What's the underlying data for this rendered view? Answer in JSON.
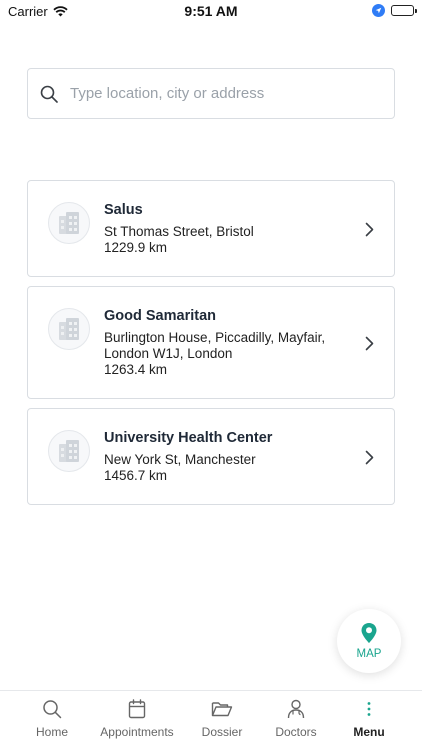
{
  "status_bar": {
    "carrier": "Carrier",
    "time": "9:51 AM"
  },
  "search": {
    "placeholder": "Type location, city or address",
    "value": ""
  },
  "facilities": [
    {
      "name": "Salus",
      "address": "St Thomas Street, Bristol",
      "distance": "1229.9 km"
    },
    {
      "name": "Good Samaritan",
      "address": "Burlington House, Piccadilly, Mayfair, London W1J, London",
      "distance": "1263.4 km"
    },
    {
      "name": "University Health Center",
      "address": "New York St, Manchester",
      "distance": "1456.7 km"
    }
  ],
  "map_button": {
    "label": "MAP"
  },
  "tab_bar": {
    "items": [
      {
        "label": "Home",
        "icon": "search-icon"
      },
      {
        "label": "Appointments",
        "icon": "calendar-icon"
      },
      {
        "label": "Dossier",
        "icon": "folder-icon"
      },
      {
        "label": "Doctors",
        "icon": "doctor-icon"
      },
      {
        "label": "Menu",
        "icon": "more-vertical-icon"
      }
    ],
    "active": "Menu"
  },
  "colors": {
    "accent": "#1aa58e",
    "border": "#d9dde2",
    "location_badge": "#2f7cf6"
  }
}
